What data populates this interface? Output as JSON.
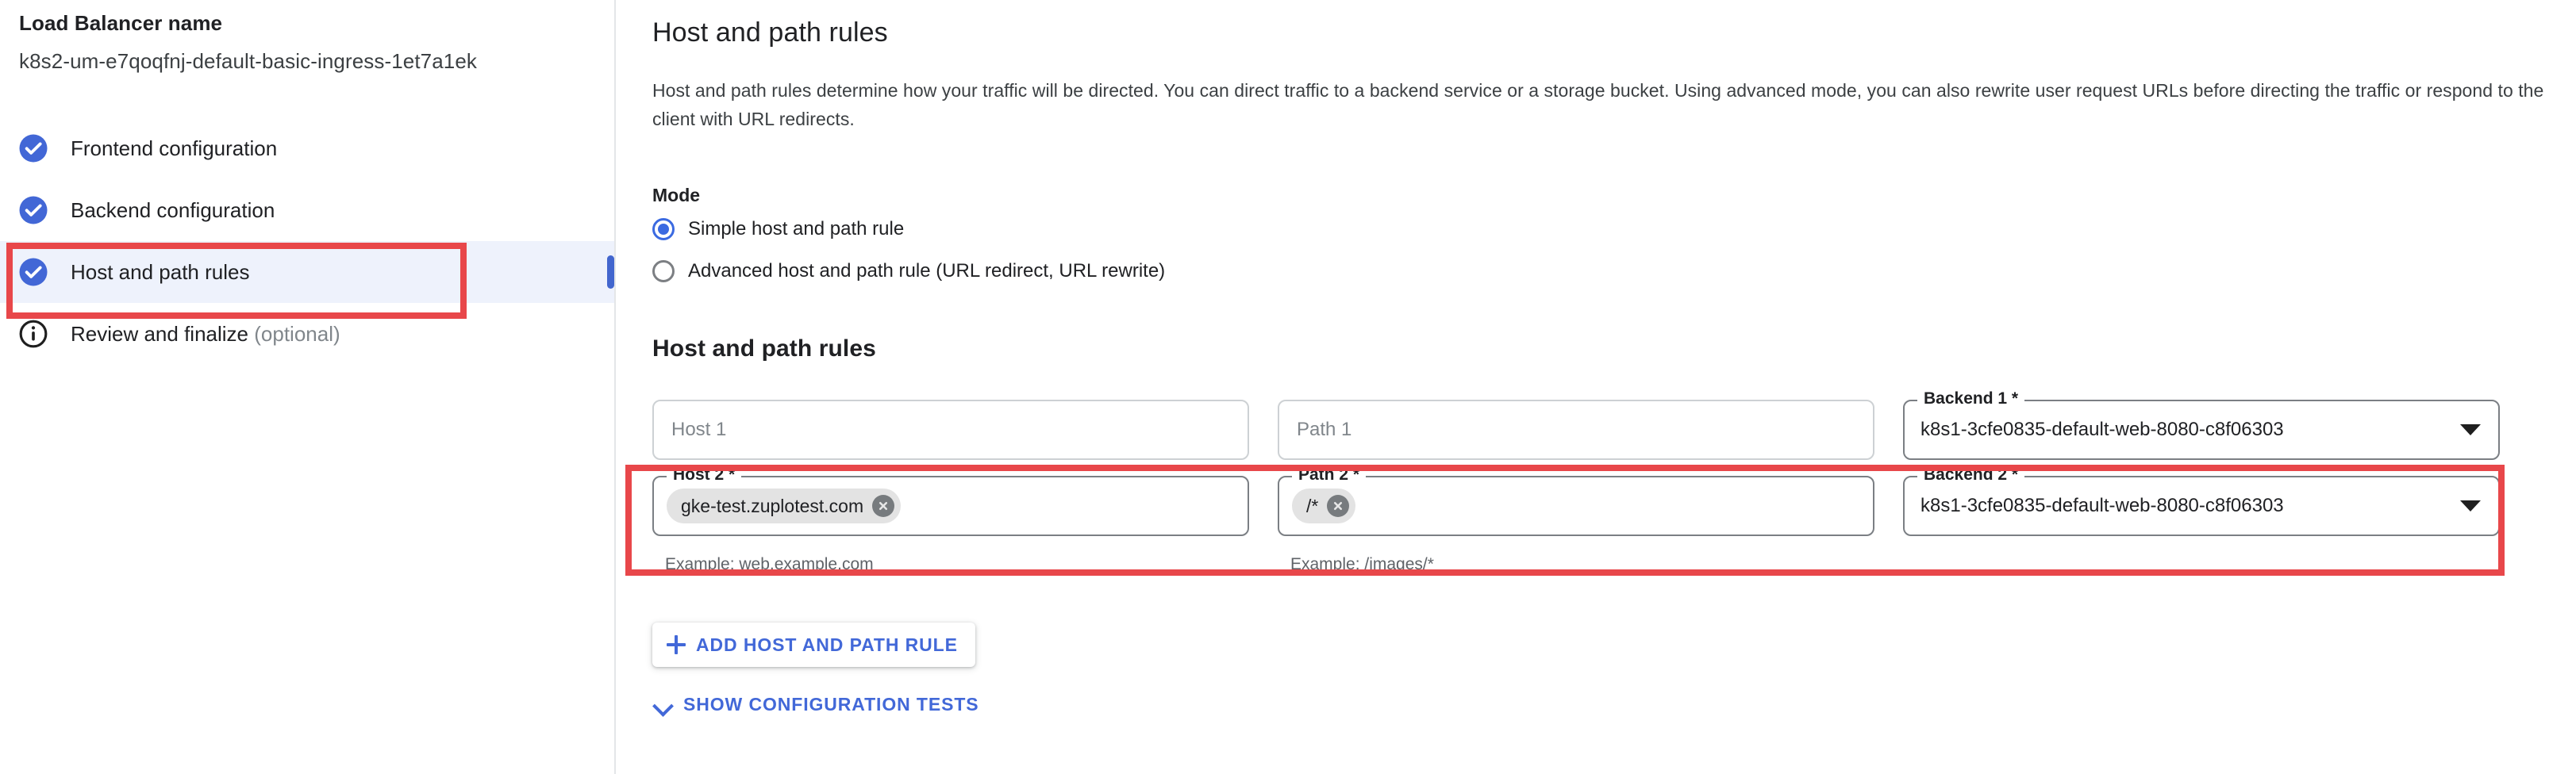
{
  "sidebar": {
    "lb_name_label": "Load Balancer name",
    "lb_name_value": "k8s2-um-e7qoqfnj-default-basic-ingress-1et7a1ek",
    "items": [
      {
        "label": "Frontend configuration",
        "icon": "check-circle-icon",
        "state": "complete"
      },
      {
        "label": "Backend configuration",
        "icon": "check-circle-icon",
        "state": "complete"
      },
      {
        "label": "Host and path rules",
        "icon": "check-circle-icon",
        "state": "complete",
        "active": true
      },
      {
        "label": "Review and finalize",
        "suffix": " (optional)",
        "icon": "info-circle-icon",
        "state": "info"
      }
    ]
  },
  "main": {
    "title": "Host and path rules",
    "description": "Host and path rules determine how your traffic will be directed. You can direct traffic to a backend service or a storage bucket. Using advanced mode, you can also rewrite user request URLs before directing the traffic or respond to the client with URL redirects.",
    "mode": {
      "label": "Mode",
      "options": [
        {
          "label": "Simple host and path rule",
          "selected": true
        },
        {
          "label": "Advanced host and path rule (URL redirect, URL rewrite)",
          "selected": false
        }
      ]
    },
    "rules_section": {
      "title": "Host and path rules",
      "rows": [
        {
          "host": {
            "placeholder": "Host 1",
            "value": ""
          },
          "path": {
            "placeholder": "Path 1",
            "value": ""
          },
          "backend": {
            "legend": "Backend 1 *",
            "value": "k8s1-3cfe0835-default-web-8080-c8f06303"
          }
        },
        {
          "host": {
            "legend": "Host 2 *",
            "chip": "gke-test.zuplotest.com",
            "helper": "Example: web.example.com"
          },
          "path": {
            "legend": "Path 2 *",
            "chip": "/*",
            "helper": "Example: /images/*"
          },
          "backend": {
            "legend": "Backend 2 *",
            "value": "k8s1-3cfe0835-default-web-8080-c8f06303"
          }
        }
      ]
    },
    "add_rule_button": "ADD HOST AND PATH RULE",
    "show_tests_button": "SHOW CONFIGURATION TESTS"
  },
  "colors": {
    "accent_blue": "#4268d8",
    "check_blue": "#4267d6",
    "annotation_red": "#e8474a",
    "active_nav_bg": "#eef2fc"
  }
}
